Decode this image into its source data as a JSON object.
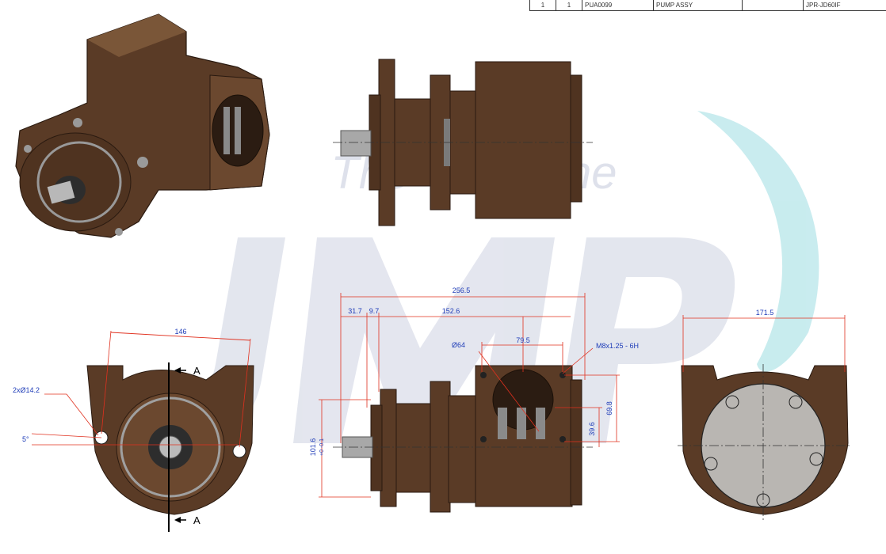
{
  "title_block": {
    "item": "1",
    "qty": "1",
    "part_no": "PUA0099",
    "description": "PUMP ASSY",
    "blank": "",
    "model": "JPR-JD60IF"
  },
  "watermark": {
    "tagline": "The Only One",
    "logo": "JMP"
  },
  "front_view": {
    "dim_width": "146",
    "dim_holes": "2xØ14.2",
    "dim_angle": "5°",
    "section_top": "A",
    "section_bottom": "A"
  },
  "side_view": {
    "dim_overall": "256.5",
    "dim_a": "31.7",
    "dim_b": "9.7",
    "dim_c": "152.6",
    "dim_port_dia": "Ø64",
    "dim_port_spacing": "79.5",
    "dim_thread": "M8x1.25 - 6H",
    "dim_port_height": "69.8",
    "dim_port_offset": "39.6",
    "dim_pilot_main": "101.6",
    "dim_pilot_tol": "+0 -0.1"
  },
  "rear_view": {
    "dim_width": "171.5"
  },
  "colors": {
    "body": "#5a3b26",
    "body_dark": "#3f281a",
    "body_light": "#7a5638",
    "dimension": "#1f3db8",
    "leader": "#e0301e",
    "watermark": "#d8dbe6",
    "watermark_teal": "#bfe9ec"
  }
}
